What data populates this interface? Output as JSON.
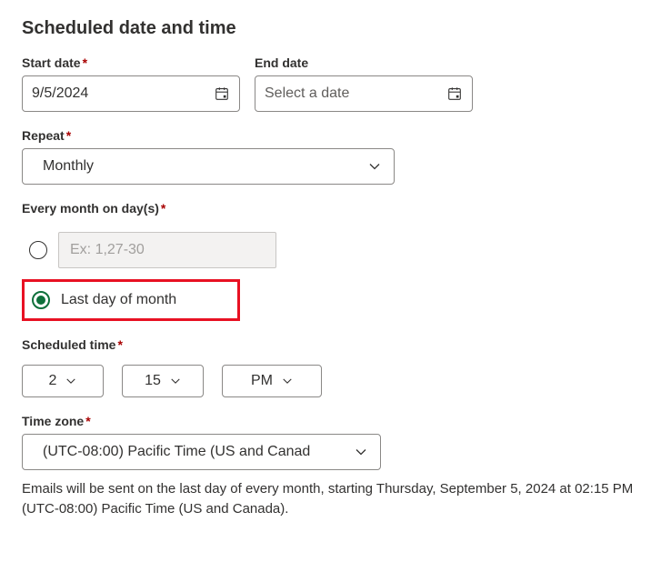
{
  "heading": "Scheduled date and time",
  "startDate": {
    "label": "Start date",
    "value": "9/5/2024"
  },
  "endDate": {
    "label": "End date",
    "placeholder": "Select a date"
  },
  "repeat": {
    "label": "Repeat",
    "value": "Monthly"
  },
  "monthDays": {
    "label": "Every month on day(s)",
    "placeholder": "Ex: 1,27-30",
    "lastDayLabel": "Last day of month"
  },
  "scheduledTime": {
    "label": "Scheduled time",
    "hour": "2",
    "minute": "15",
    "ampm": "PM"
  },
  "timezone": {
    "label": "Time zone",
    "value": "(UTC-08:00) Pacific Time (US and Canad"
  },
  "summary": "Emails will be sent on the last day of every month, starting Thursday, September 5, 2024 at 02:15 PM (UTC-08:00) Pacific Time (US and Canada)."
}
